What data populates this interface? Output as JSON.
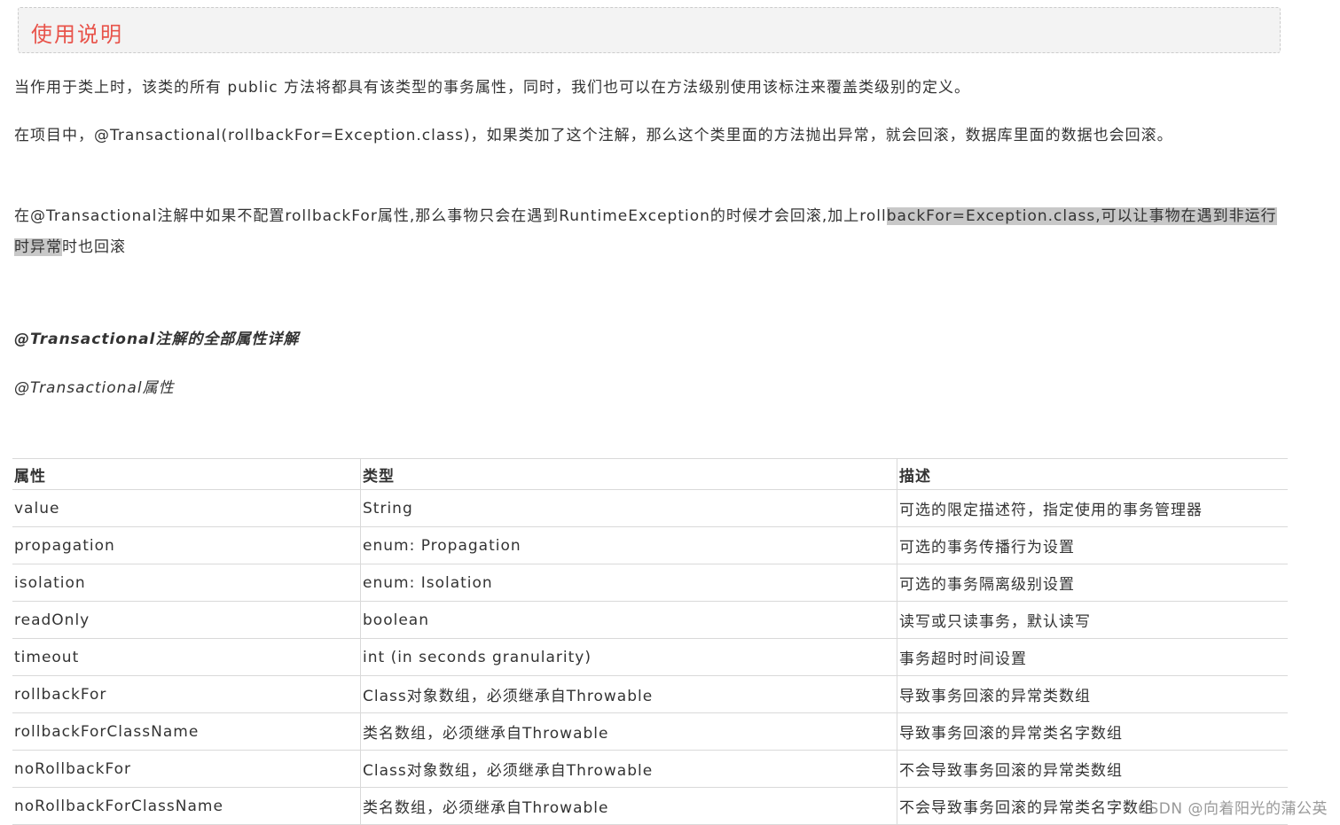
{
  "notice": {
    "title": "使用说明"
  },
  "paragraphs": {
    "p1": "当作用于类上时，该类的所有 public 方法将都具有该类型的事务属性，同时，我们也可以在方法级别使用该标注来覆盖类级别的定义。",
    "p2": "在项目中，@Transactional(rollbackFor=Exception.class)，如果类加了这个注解，那么这个类里面的方法抛出异常，就会回滚，数据库里面的数据也会回滚。",
    "p3_plain": "在@Transactional注解中如果不配置rollbackFor属性,那么事物只会在遇到RuntimeException的时候才会回滚,加上roll",
    "p3_highlight": "backFor=Exception.class,可以让事物在遇到非运行时异常",
    "p3_tail": "时也回滚"
  },
  "section": {
    "title": "@Transactional注解的全部属性详解",
    "subtitle": "@Transactional属性"
  },
  "table": {
    "headers": [
      "属性",
      "类型",
      "描述"
    ],
    "rows": [
      [
        "value",
        "String",
        "可选的限定描述符，指定使用的事务管理器"
      ],
      [
        "propagation",
        "enum: Propagation",
        "可选的事务传播行为设置"
      ],
      [
        "isolation",
        "enum: Isolation",
        "可选的事务隔离级别设置"
      ],
      [
        "readOnly",
        "boolean",
        "读写或只读事务，默认读写"
      ],
      [
        "timeout",
        "int (in seconds granularity)",
        "事务超时时间设置"
      ],
      [
        "rollbackFor",
        "Class对象数组，必须继承自Throwable",
        "导致事务回滚的异常类数组"
      ],
      [
        "rollbackForClassName",
        "类名数组，必须继承自Throwable",
        "导致事务回滚的异常类名字数组"
      ],
      [
        "noRollbackFor",
        "Class对象数组，必须继承自Throwable",
        "不会导致事务回滚的异常类数组"
      ],
      [
        "noRollbackForClassName",
        "类名数组，必须继承自Throwable",
        "不会导致事务回滚的异常类名字数组"
      ]
    ]
  },
  "watermark": "CSDN @向着阳光的蒲公英"
}
